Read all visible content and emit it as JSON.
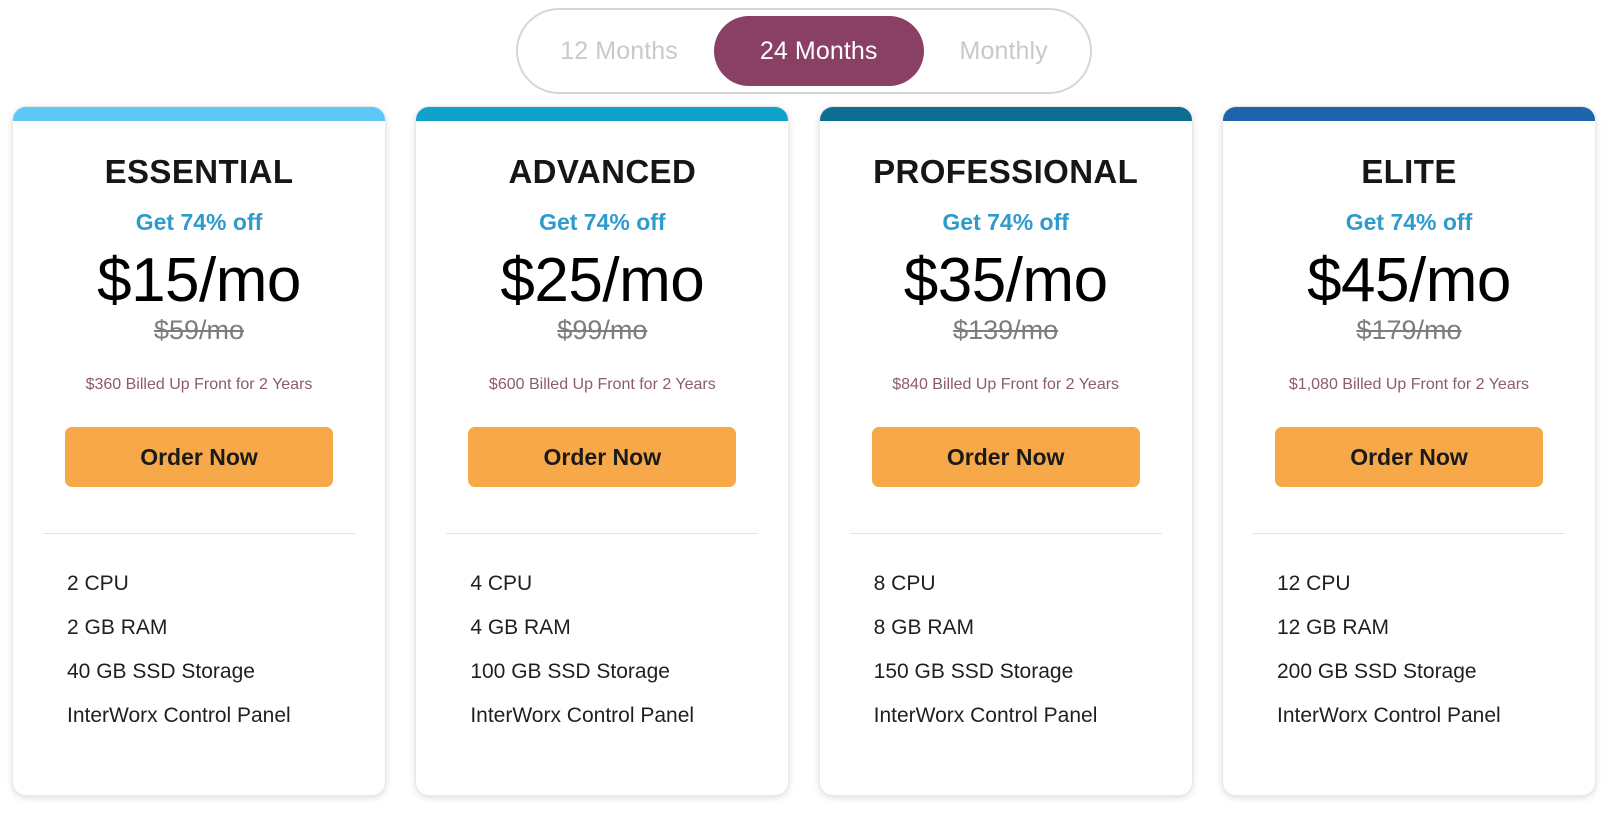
{
  "billing_toggle": {
    "options": [
      {
        "label": "12 Months",
        "active": false
      },
      {
        "label": "24 Months",
        "active": true
      },
      {
        "label": "Monthly",
        "active": false
      }
    ],
    "active_color": "#8A3F64",
    "inactive_color": "#c9c9c9"
  },
  "cta_color": "#F7A94A",
  "discount_color": "#2E9BCB",
  "billed_note_color": "#8C5A73",
  "plans": [
    {
      "name": "ESSENTIAL",
      "accent_color": "#5BC8F5",
      "discount": "Get 74% off",
      "price": "$15/mo",
      "old_price": "$59/mo",
      "billed": "$360 Billed Up Front for 2 Years",
      "cta": "Order Now",
      "specs": [
        "2 CPU",
        "2 GB RAM",
        "40 GB SSD Storage",
        "InterWorx Control Panel"
      ]
    },
    {
      "name": "ADVANCED",
      "accent_color": "#0FA3CB",
      "discount": "Get 74% off",
      "price": "$25/mo",
      "old_price": "$99/mo",
      "billed": "$600 Billed Up Front for 2 Years",
      "cta": "Order Now",
      "specs": [
        "4 CPU",
        "4 GB RAM",
        "100 GB SSD Storage",
        "InterWorx Control Panel"
      ]
    },
    {
      "name": "PROFESSIONAL",
      "accent_color": "#0E6E92",
      "discount": "Get 74% off",
      "price": "$35/mo",
      "old_price": "$139/mo",
      "billed": "$840 Billed Up Front for 2 Years",
      "cta": "Order Now",
      "specs": [
        "8 CPU",
        "8 GB RAM",
        "150 GB SSD Storage",
        "InterWorx Control Panel"
      ]
    },
    {
      "name": "ELITE",
      "accent_color": "#1E63AE",
      "discount": "Get 74% off",
      "price": "$45/mo",
      "old_price": "$179/mo",
      "billed": "$1,080 Billed Up Front for 2 Years",
      "cta": "Order Now",
      "specs": [
        "12 CPU",
        "12 GB RAM",
        "200 GB SSD Storage",
        "InterWorx Control Panel"
      ]
    }
  ]
}
